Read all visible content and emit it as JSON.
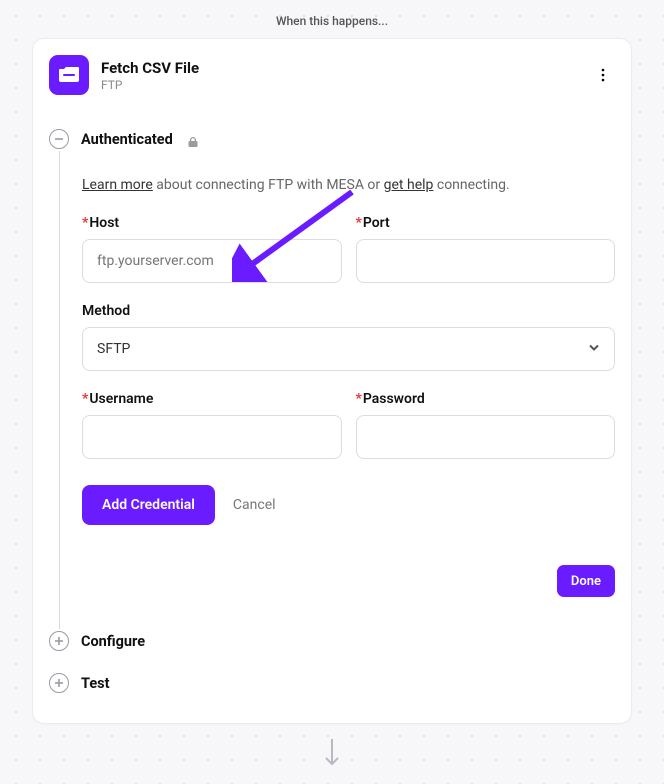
{
  "top_label": "When this happens...",
  "header": {
    "title": "Fetch CSV File",
    "subtitle": "FTP"
  },
  "sections": {
    "authenticated": {
      "label": "Authenticated"
    },
    "configure": {
      "label": "Configure"
    },
    "test": {
      "label": "Test"
    }
  },
  "help": {
    "learn_more": "Learn more",
    "middle1": " about connecting FTP with MESA or ",
    "get_help": "get help",
    "middle2": " connecting."
  },
  "fields": {
    "host": {
      "label": "Host",
      "placeholder": "ftp.yourserver.com",
      "value": ""
    },
    "port": {
      "label": "Port",
      "placeholder": "",
      "value": ""
    },
    "method": {
      "label": "Method",
      "value": "SFTP"
    },
    "username": {
      "label": "Username",
      "value": ""
    },
    "password": {
      "label": "Password",
      "value": ""
    }
  },
  "buttons": {
    "add_credential": "Add Credential",
    "cancel": "Cancel",
    "done": "Done"
  },
  "colors": {
    "accent": "#6a1bff"
  }
}
